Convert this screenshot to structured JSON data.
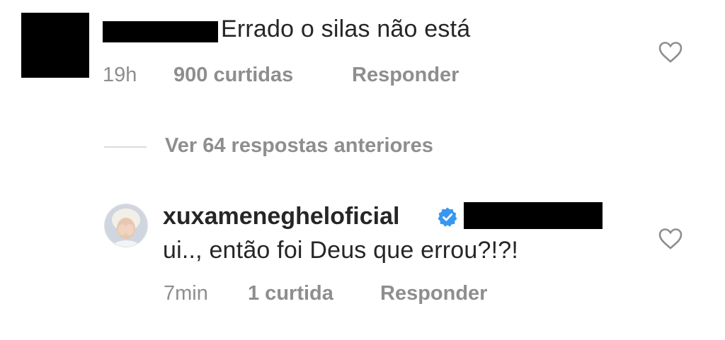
{
  "comment1": {
    "text": "Errado o silas não está",
    "time": "19h",
    "likes": "900 curtidas",
    "reply_label": "Responder",
    "like_icon": "heart-outline"
  },
  "thread": {
    "view_previous": "Ver 64 respostas anteriores"
  },
  "reply1": {
    "username": "xuxameneghelofi cial",
    "text": "ui.., então foi Deus que errou?!?!",
    "time": "7min",
    "likes": "1 curtida",
    "reply_label": "Responder",
    "verified_icon": "verified-badge",
    "like_icon": "heart-outline"
  },
  "colors": {
    "text": "#262626",
    "muted": "#8e8e8e",
    "verified": "#3897f0",
    "divider": "#dbdbdb"
  }
}
